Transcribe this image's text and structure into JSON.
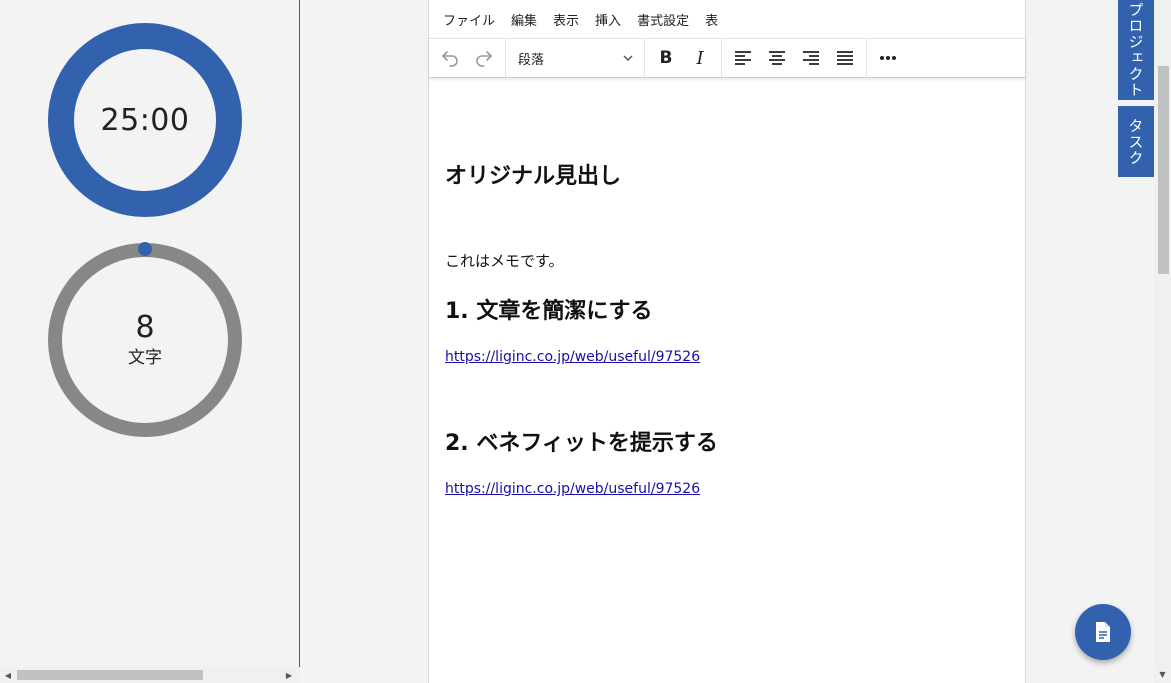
{
  "timer": {
    "display": "25:00"
  },
  "counter": {
    "count": "8",
    "unit": "文字"
  },
  "menu": [
    "ファイル",
    "編集",
    "表示",
    "挿入",
    "書式設定",
    "表"
  ],
  "toolbar": {
    "block_format": "段落",
    "bold": "B",
    "italic": "I",
    "more": "•••"
  },
  "document": {
    "heading": "オリジナル見出し",
    "memo": "これはメモです。",
    "section1": "1. 文章を簡潔にする",
    "link1": "https://liginc.co.jp/web/useful/97526",
    "section2": "2. ベネフィットを提示する",
    "link2": "https://liginc.co.jp/web/useful/97526"
  },
  "side_tabs": {
    "project": "プロジェクト",
    "task": "タスク"
  },
  "colors": {
    "accent": "#3262ad",
    "ring_gray": "#878787"
  },
  "icons": {
    "fab": "document-icon"
  }
}
